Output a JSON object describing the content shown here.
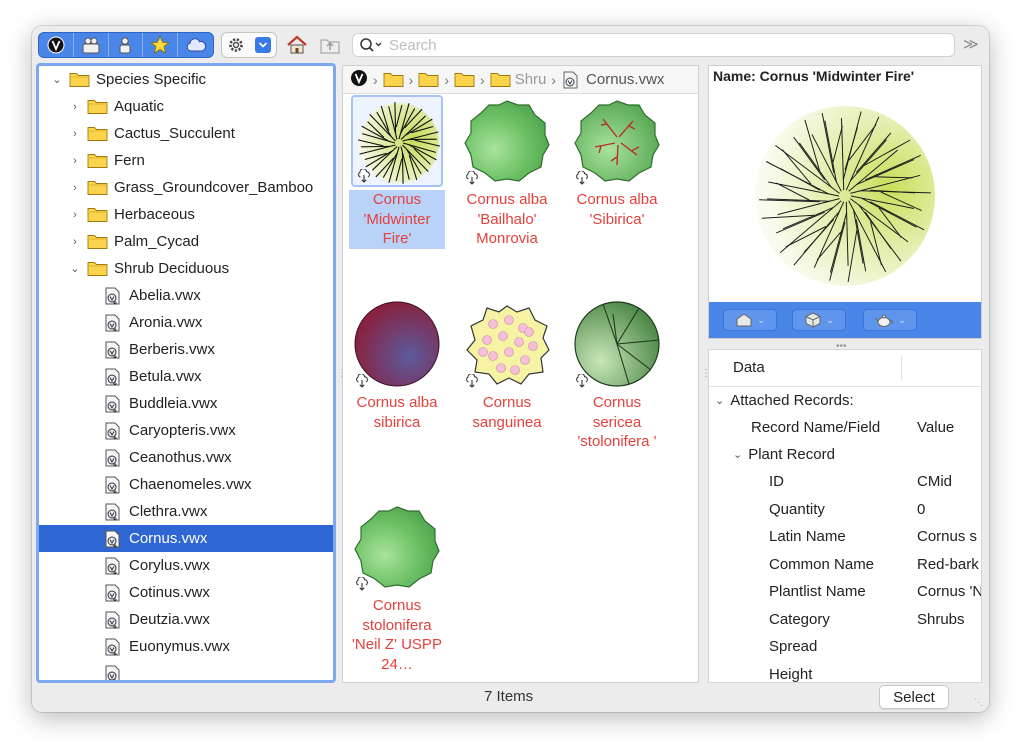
{
  "search": {
    "placeholder": "Search"
  },
  "toolbar": {
    "blue_buttons": [
      "vectorworks-logo-icon",
      "people-library-icon",
      "person-library-icon",
      "favorites-star-icon",
      "cloud-icon"
    ],
    "more_label": "≫"
  },
  "tree": {
    "root": "Species Specific",
    "folders": [
      "Aquatic",
      "Cactus_Succulent",
      "Fern",
      "Grass_Groundcover_Bamboo",
      "Herbaceous",
      "Palm_Cycad",
      "Shrub Deciduous"
    ],
    "files": [
      "Abelia.vwx",
      "Aronia.vwx",
      "Berberis.vwx",
      "Betula.vwx",
      "Buddleia.vwx",
      "Caryopteris.vwx",
      "Ceanothus.vwx",
      "Chaenomeles.vwx",
      "Clethra.vwx",
      "Cornus.vwx",
      "Corylus.vwx",
      "Cotinus.vwx",
      "Deutzia.vwx",
      "Euonymus.vwx"
    ],
    "selected_file": "Cornus.vwx"
  },
  "breadcrumb": {
    "partial_folder": "Shru",
    "file": "Cornus.vwx"
  },
  "tiles": [
    {
      "label": "Cornus 'Midwinter Fire'",
      "selected": true,
      "icon": "spiky-pale-shrub"
    },
    {
      "label": "Cornus alba 'Bailhalo' Monrovia",
      "selected": false,
      "icon": "green-round-shrub"
    },
    {
      "label": "Cornus alba 'Sibirica'",
      "selected": false,
      "icon": "green-shrub-red-stems"
    },
    {
      "label": "Cornus alba sibirica",
      "selected": false,
      "icon": "purple-circle"
    },
    {
      "label": "Cornus sanguinea",
      "selected": false,
      "icon": "yellow-pink-dotted"
    },
    {
      "label": "Cornus sericea 'stolonifera '",
      "selected": false,
      "icon": "green-segmented"
    },
    {
      "label": "Cornus stolonifera 'Neil Z' USPP 24…",
      "selected": false,
      "icon": "green-round-shrub"
    }
  ],
  "preview": {
    "name_label": "Name: Cornus 'Midwinter Fire'"
  },
  "data_panel": {
    "tab": "Data",
    "attached": "Attached Records:",
    "col_name": "Record Name/Field",
    "col_value": "Value",
    "record": "Plant Record",
    "fields": [
      {
        "name": "ID",
        "value": "CMid"
      },
      {
        "name": "Quantity",
        "value": "0"
      },
      {
        "name": "Latin Name",
        "value": "Cornus s"
      },
      {
        "name": "Common Name",
        "value": "Red-bark"
      },
      {
        "name": "Plantlist Name",
        "value": "Cornus 'N"
      },
      {
        "name": "Category",
        "value": "Shrubs"
      },
      {
        "name": "Spread",
        "value": ""
      },
      {
        "name": "Height",
        "value": ""
      }
    ]
  },
  "status": {
    "count": "7 Items",
    "select_label": "Select"
  }
}
